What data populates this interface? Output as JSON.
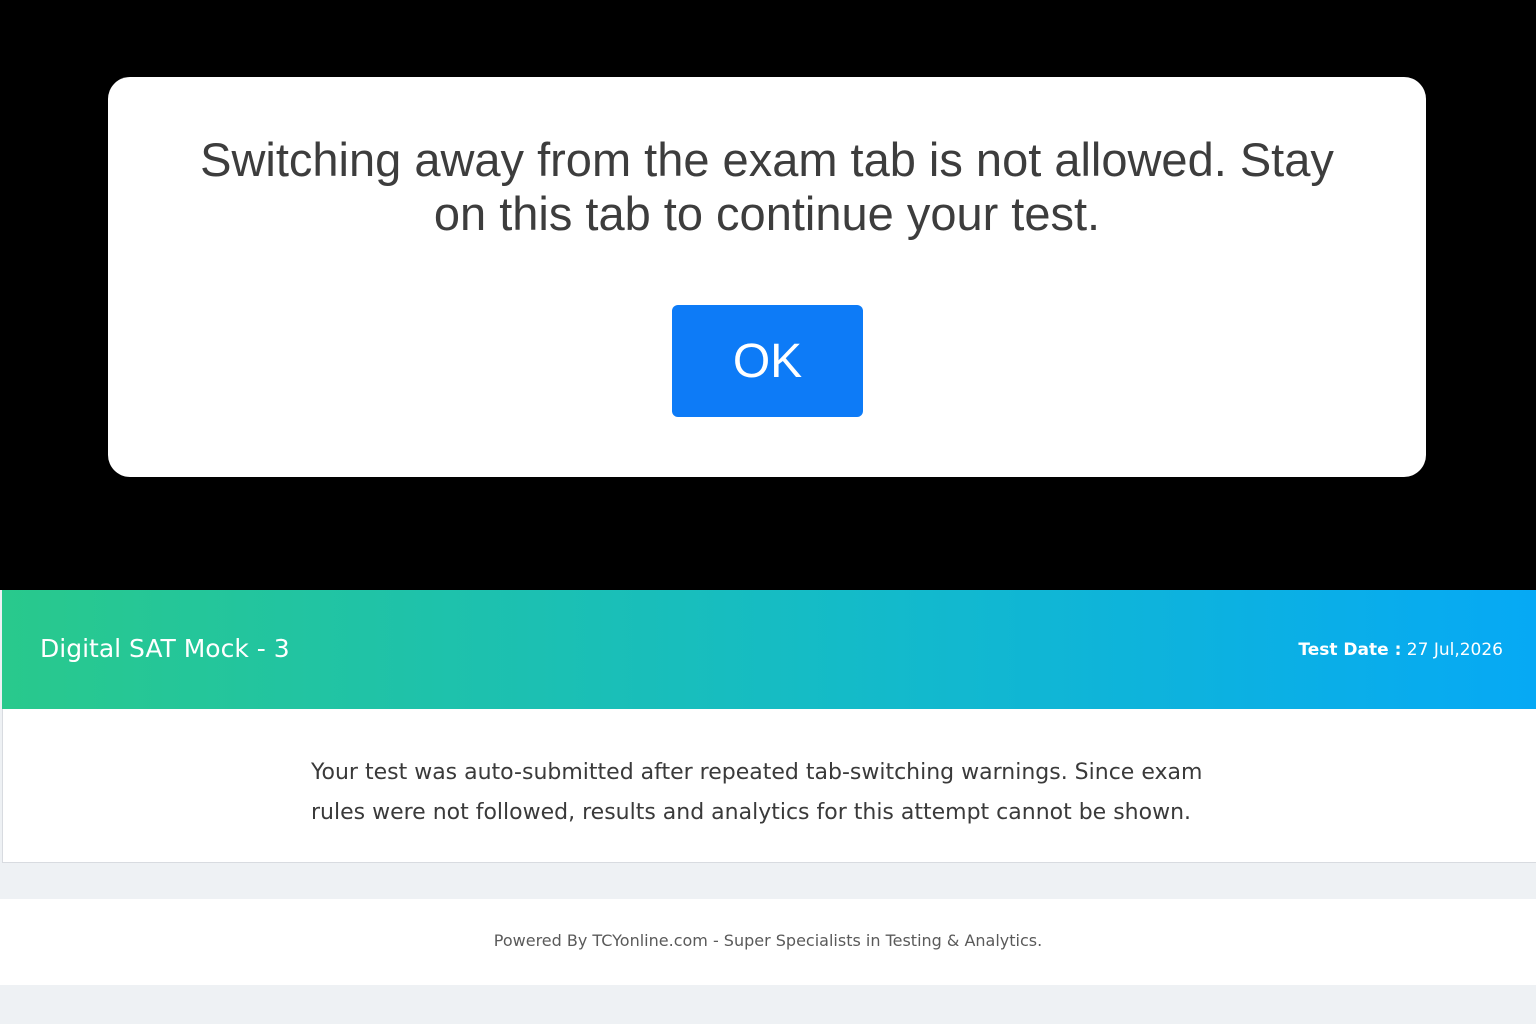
{
  "modal": {
    "message": "Switching away from the exam tab is not allowed. Stay on this tab to continue your test.",
    "ok_label": "OK",
    "button_color": "#0d7bf7"
  },
  "header": {
    "title": "Digital SAT Mock - 3",
    "date_label": "Test Date :",
    "date_value": "27 Jul,2026",
    "gradient_start": "#29c98c",
    "gradient_end": "#06a9f5"
  },
  "notice": {
    "text": "Your test was auto-submitted after repeated tab-switching warnings. Since exam rules were not followed, results and analytics for this attempt cannot be shown."
  },
  "footer": {
    "text": "Powered By TCYonline.com - Super Specialists in Testing & Analytics."
  }
}
